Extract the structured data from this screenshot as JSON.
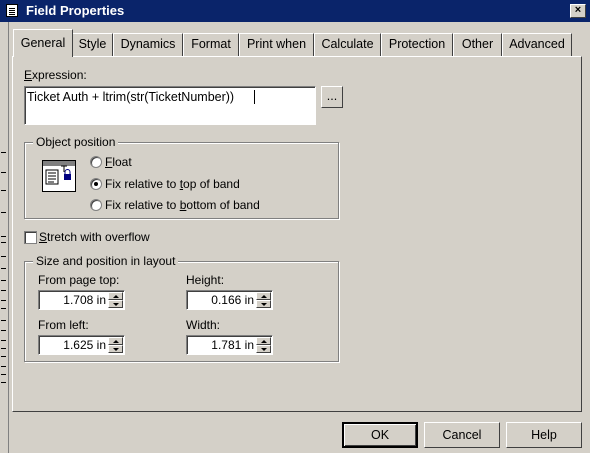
{
  "window": {
    "title": "Field Properties",
    "close_glyph": "×"
  },
  "tabs": [
    {
      "label": "General",
      "active": true
    },
    {
      "label": "Style"
    },
    {
      "label": "Dynamics"
    },
    {
      "label": "Format"
    },
    {
      "label": "Print when"
    },
    {
      "label": "Calculate"
    },
    {
      "label": "Protection"
    },
    {
      "label": "Other"
    },
    {
      "label": "Advanced"
    }
  ],
  "expression": {
    "label": "Expression:",
    "value": "Ticket Auth + ltrim(str(TicketNumber))",
    "browse_label": "..."
  },
  "object_position": {
    "title": "Object position",
    "icon": "object-position-icon",
    "options": [
      "Float",
      "Fix relative to top of band",
      "Fix relative to bottom of band"
    ],
    "selected": "Fix relative to top of band"
  },
  "stretch": {
    "label": "Stretch with overflow",
    "checked": false
  },
  "size_position": {
    "title": "Size and position in layout",
    "from_page_top": {
      "label": "From page top:",
      "value": "1.708 in"
    },
    "height": {
      "label": "Height:",
      "value": "0.166 in"
    },
    "from_left": {
      "label": "From left:",
      "value": "1.625 in"
    },
    "width": {
      "label": "Width:",
      "value": "1.781 in"
    }
  },
  "buttons": {
    "ok": "OK",
    "cancel": "Cancel",
    "help": "Help"
  }
}
